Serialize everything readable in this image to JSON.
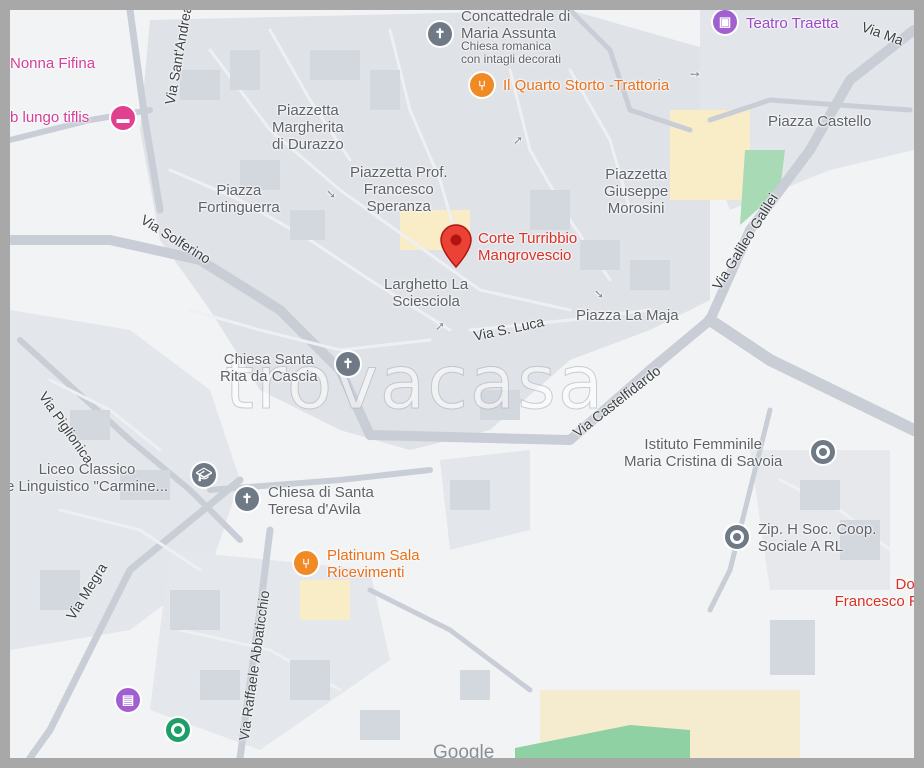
{
  "map": {
    "watermark": "trovacasa",
    "attribution": "Google",
    "selected_place": "Corte Turribbio\nMangrovescio",
    "places": {
      "concattedrale": "Concattedrale di\nMaria Assunta",
      "concattedrale_desc": "Chiesa romanica\ncon intagli decorati",
      "teatro": "Teatro Traetta",
      "nonna": "Nonna Fifina",
      "bb": "b lungo tiflis",
      "quarto": "Il Quarto Storto -Trattoria",
      "chiesa_rita": "Chiesa Santa\nRita da Cascia",
      "liceo": "Liceo Classico\ne Linguistico \"Carmine...",
      "chiesa_teresa": "Chiesa di Santa\nTeresa d'Avila",
      "platinum": "Platinum Sala\nRicevimenti",
      "istituto": "Istituto Femminile\nMaria Cristina di Savoia",
      "zip": "Zip. H Soc. Coop.\nSociale A RL",
      "dott": "Dott\nFrancesco Ri"
    },
    "areas": {
      "piazzetta_margherita": "Piazzetta\nMargherita\ndi Durazzo",
      "piazzetta_prof": "Piazzetta Prof.\nFrancesco\nSperanza",
      "piazza_fortinguerra": "Piazza\nFortinguerra",
      "piazzetta_morosini": "Piazzetta\nGiuseppe\nMorosini",
      "piazza_castello": "Piazza Castello",
      "larghetto": "Larghetto La\nSciesciola",
      "piazza_maja": "Piazza La Maja"
    },
    "streets": {
      "via_ma": "Via Ma",
      "via_sant_andrea": "Via Sant'Andrea",
      "via_solferino": "Via Solferino",
      "via_galileo": "Via Galileo Galilei",
      "via_s_luca": "Via S. Luca",
      "via_castelfidardo": "Via Castelfidardo",
      "via_piglionica": "Via Piglionica",
      "via_megra": "Via Megra",
      "via_abbaticchio": "Via Raffaele Abbaticchio"
    }
  }
}
